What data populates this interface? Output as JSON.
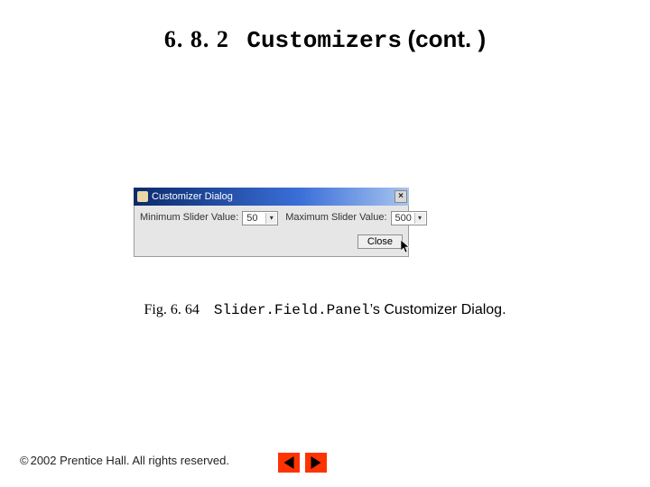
{
  "heading": {
    "section_number": "6. 8. 2",
    "section_title": "Customizers",
    "cont": "(cont. )"
  },
  "dialog": {
    "title": "Customizer Dialog",
    "close_glyph": "×",
    "min_label": "Minimum Slider Value:",
    "min_value": "50",
    "max_label": "Maximum Slider Value:",
    "max_value": "500",
    "close_button": "Close"
  },
  "caption": {
    "fig": "Fig. 6. 64",
    "classname": "Slider.Field.Panel",
    "rest": "’s Customizer Dialog."
  },
  "footer": {
    "copyright_symbol": "©",
    "text": "2002 Prentice Hall.  All rights reserved."
  }
}
